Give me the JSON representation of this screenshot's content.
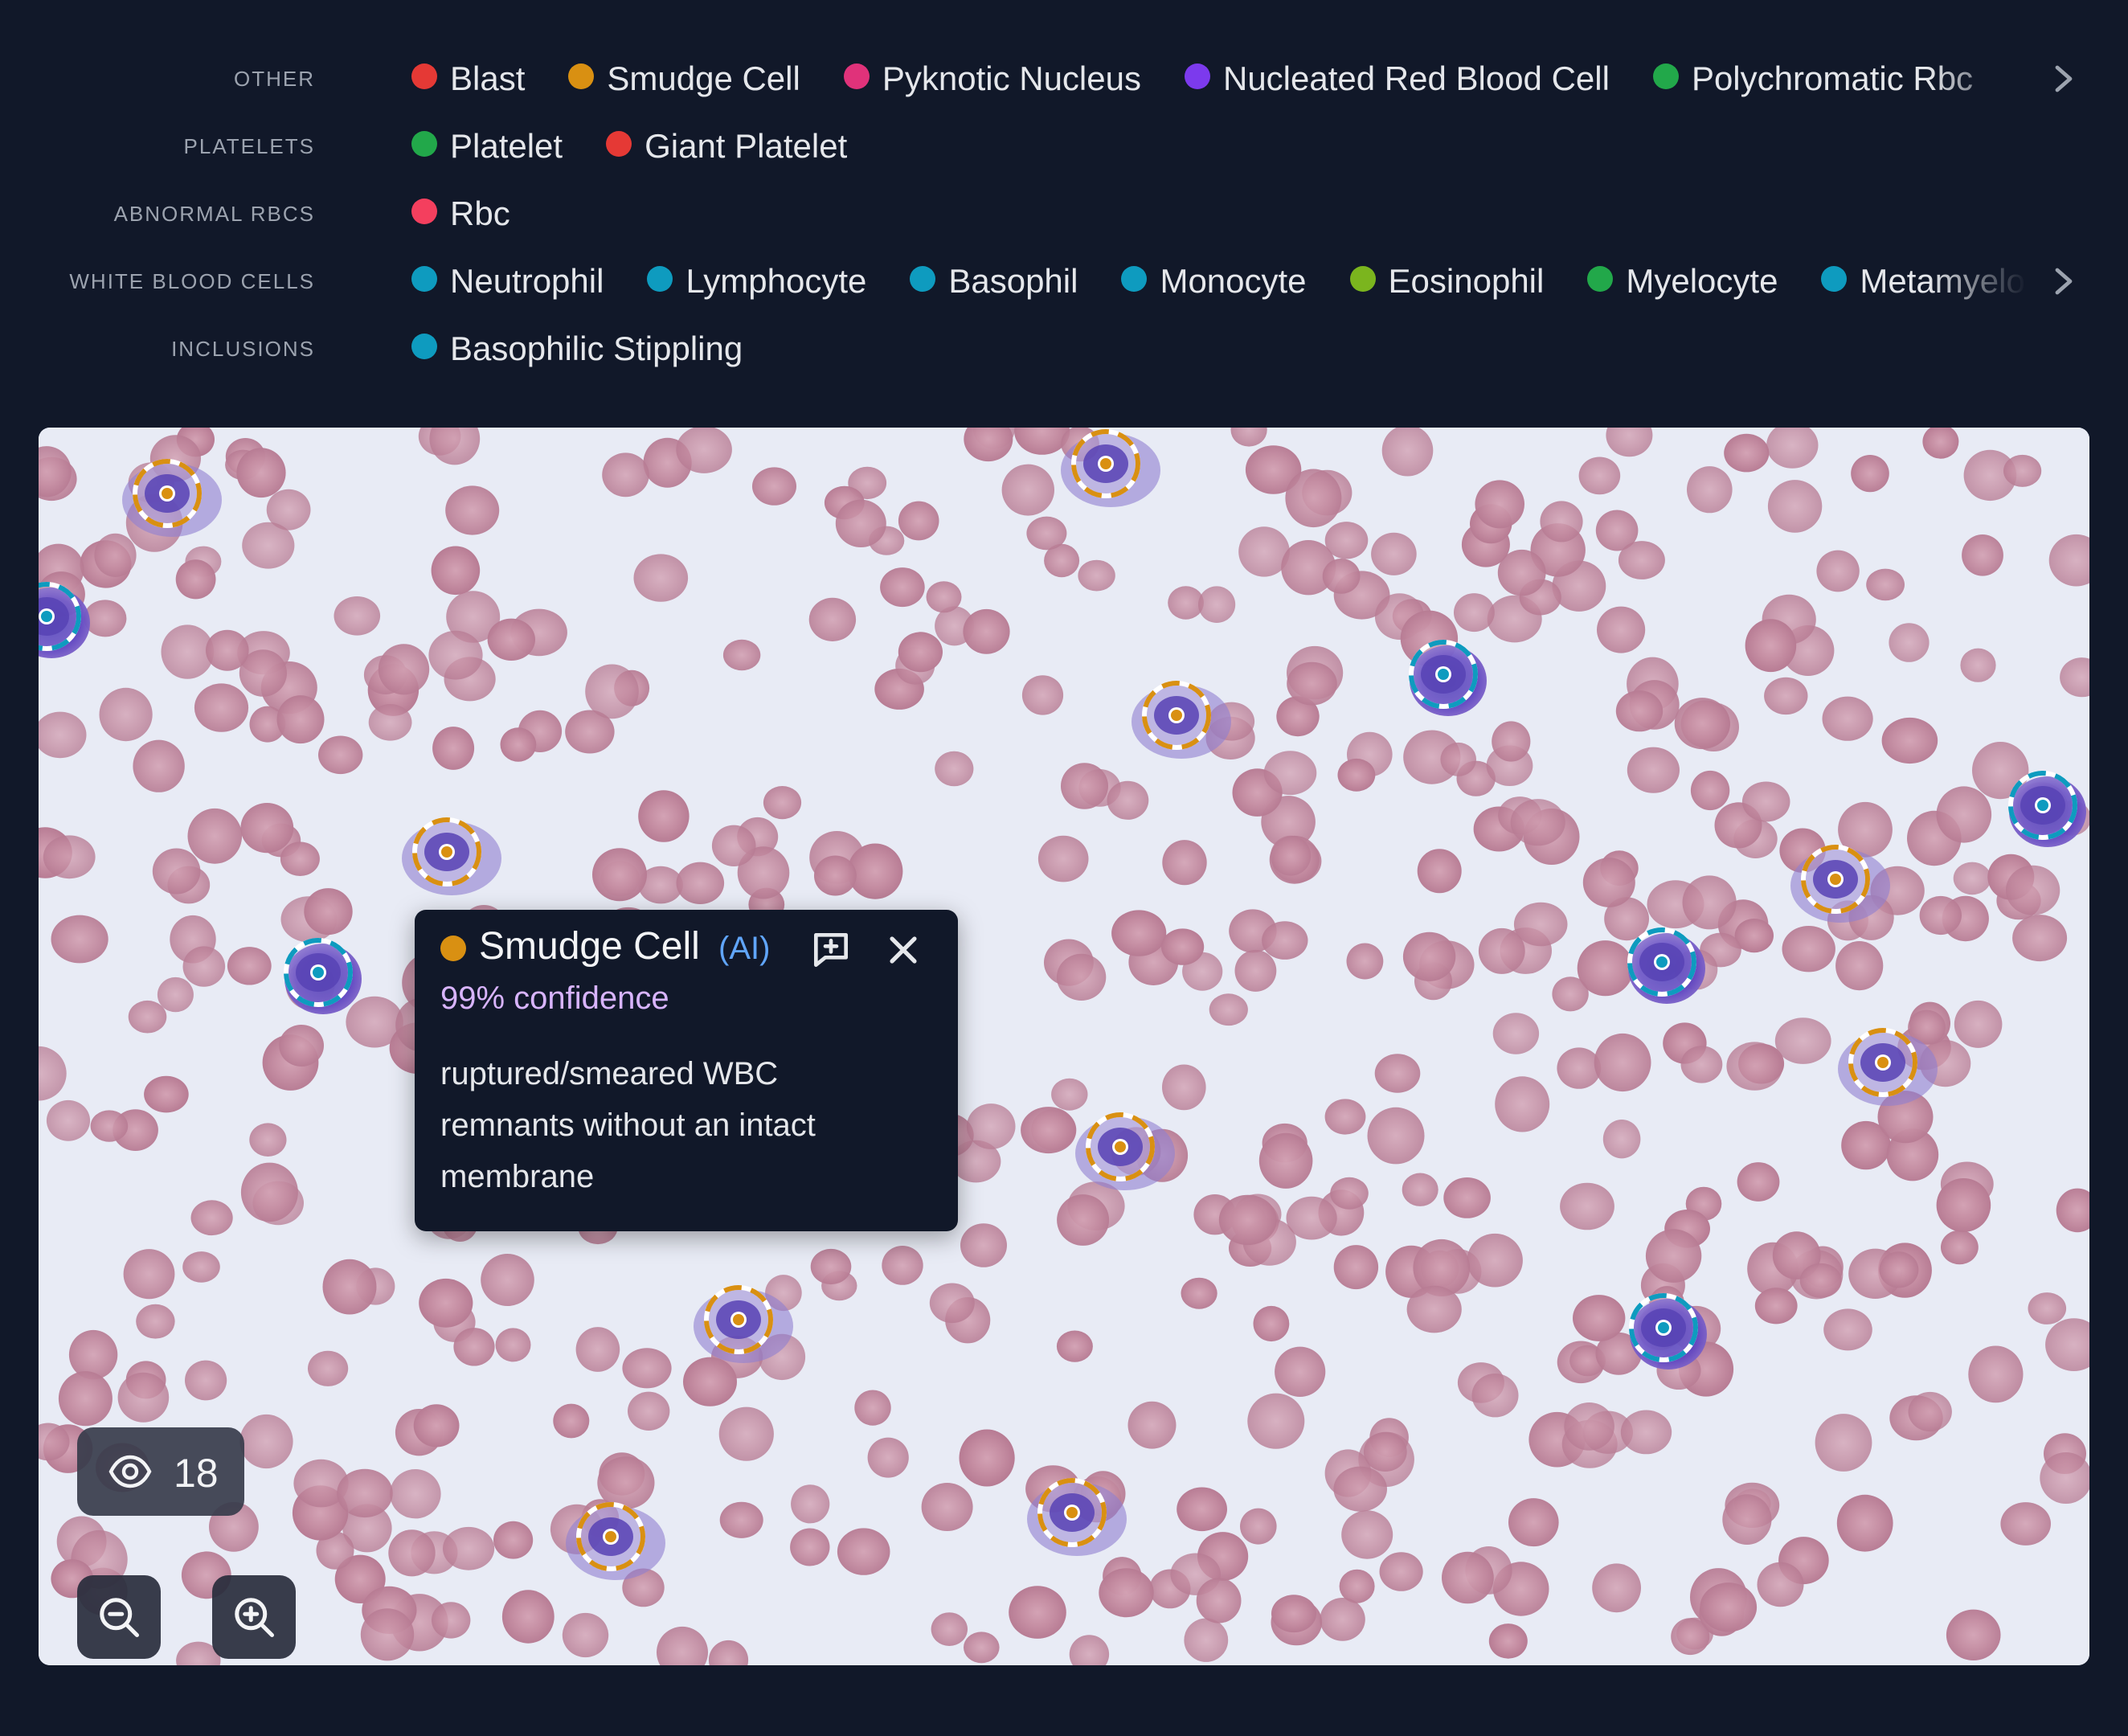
{
  "legend": {
    "rows": [
      {
        "category": "OTHER",
        "items": [
          {
            "label": "Blast",
            "color": "#e53935"
          },
          {
            "label": "Smudge Cell",
            "color": "#d99012"
          },
          {
            "label": "Pyknotic Nucleus",
            "color": "#e0327a"
          },
          {
            "label": "Nucleated Red Blood Cell",
            "color": "#7c3aed"
          },
          {
            "label": "Polychromatic Rbc",
            "color": "#22a84a"
          }
        ],
        "has_more": true
      },
      {
        "category": "PLATELETS",
        "items": [
          {
            "label": "Platelet",
            "color": "#22a84a"
          },
          {
            "label": "Giant Platelet",
            "color": "#e53935"
          }
        ],
        "has_more": false
      },
      {
        "category": "ABNORMAL RBCS",
        "items": [
          {
            "label": "Rbc",
            "color": "#f43f5e"
          }
        ],
        "has_more": false
      },
      {
        "category": "WHITE BLOOD CELLS",
        "items": [
          {
            "label": "Neutrophil",
            "color": "#0e9bbf"
          },
          {
            "label": "Lymphocyte",
            "color": "#0e9bbf"
          },
          {
            "label": "Basophil",
            "color": "#0e9bbf"
          },
          {
            "label": "Monocyte",
            "color": "#0e9bbf"
          },
          {
            "label": "Eosinophil",
            "color": "#7bb51e"
          },
          {
            "label": "Myelocyte",
            "color": "#22a84a"
          },
          {
            "label": "Metamyelocyte",
            "color": "#0e9bbf"
          }
        ],
        "has_more": true
      },
      {
        "category": "INCLUSIONS",
        "items": [
          {
            "label": "Basophilic Stippling",
            "color": "#0e9bbf"
          }
        ],
        "has_more": false
      }
    ]
  },
  "tooltip": {
    "label": "Smudge Cell",
    "source": "(AI)",
    "confidence": "99% confidence",
    "description": "ruptured/smeared WBC remnants without an intact membrane",
    "dot_color": "#d99012"
  },
  "viewer": {
    "visible_count": "18",
    "icons": {
      "count": "eye-icon",
      "zoom_out": "zoom-out-icon",
      "zoom_in": "zoom-in-icon",
      "note": "add-comment-icon",
      "close": "close-icon"
    }
  }
}
